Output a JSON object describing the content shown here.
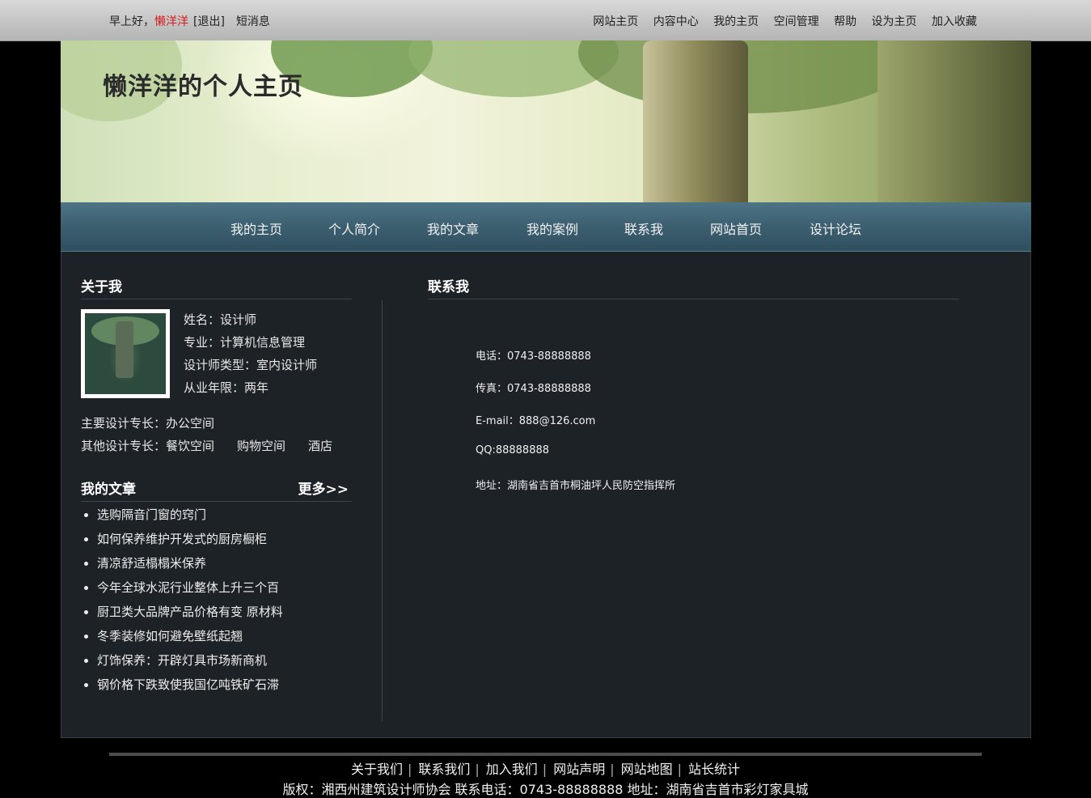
{
  "topbar": {
    "greeting": "早上好，",
    "username": "懒洋洋",
    "logout": "[退出]",
    "messages": "短消息",
    "links": [
      "网站主页",
      "内容中心",
      "我的主页",
      "空间管理",
      "帮助",
      "设为主页",
      "加入收藏"
    ]
  },
  "banner": {
    "title": "懒洋洋的个人主页"
  },
  "nav": [
    "我的主页",
    "个人简介",
    "我的文章",
    "我的案例",
    "联系我",
    "网站首页",
    "设计论坛"
  ],
  "about": {
    "title": "关于我",
    "profile": [
      "姓名：设计师",
      "专业：计算机信息管理",
      "设计师类型：室内设计师",
      "从业年限：两年"
    ],
    "main_skill": "主要设计专长：办公空间",
    "other_skill_label": "其他设计专长：餐饮空间",
    "other_skill_2": "购物空间",
    "other_skill_3": "酒店"
  },
  "articles": {
    "title": "我的文章",
    "more": "更多>>",
    "items": [
      "选购隔音门窗的窍门",
      "如何保养维护开发式的厨房橱柜",
      "清凉舒适榻榻米保养",
      "今年全球水泥行业整体上升三个百",
      "厨卫类大品牌产品价格有变 原材料",
      "冬季装修如何避免壁纸起翘",
      "灯饰保养：开辟灯具市场新商机",
      "钢价格下跌致使我国亿吨铁矿石滞"
    ]
  },
  "contact": {
    "title": "联系我",
    "lines": [
      "电话：0743-88888888",
      "传真：0743-88888888",
      "E-mail：888@126.com",
      "QQ:88888888",
      "地址：湖南省吉首市桐油坪人民防空指挥所"
    ]
  },
  "footer": {
    "links": [
      "关于我们",
      "联系我们",
      "加入我们",
      "网站声明",
      "网站地图",
      "站长统计"
    ],
    "copyright": "版权：湘西州建筑设计师协会 联系电话：0743-88888888 地址：湖南省吉首市彩灯家具城"
  },
  "colors": {
    "username": "#d61a1a",
    "nav_bg": "#3c5f70",
    "main_bg": "#1c2226"
  }
}
